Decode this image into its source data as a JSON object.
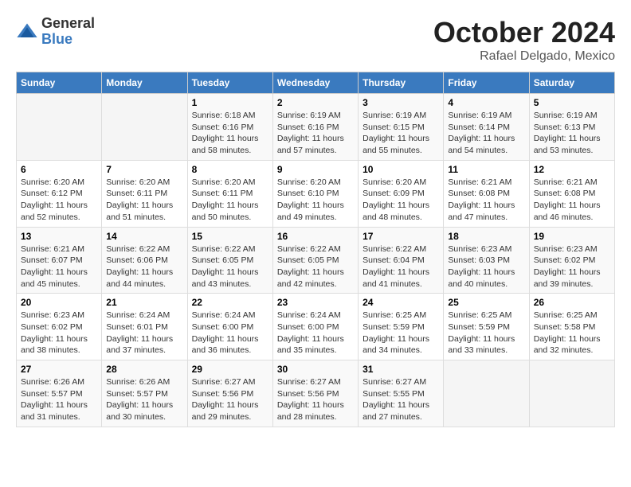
{
  "logo": {
    "general": "General",
    "blue": "Blue"
  },
  "header": {
    "month": "October 2024",
    "location": "Rafael Delgado, Mexico"
  },
  "weekdays": [
    "Sunday",
    "Monday",
    "Tuesday",
    "Wednesday",
    "Thursday",
    "Friday",
    "Saturday"
  ],
  "weeks": [
    [
      {
        "day": "",
        "info": ""
      },
      {
        "day": "",
        "info": ""
      },
      {
        "day": "1",
        "info": "Sunrise: 6:18 AM\nSunset: 6:16 PM\nDaylight: 11 hours and 58 minutes."
      },
      {
        "day": "2",
        "info": "Sunrise: 6:19 AM\nSunset: 6:16 PM\nDaylight: 11 hours and 57 minutes."
      },
      {
        "day": "3",
        "info": "Sunrise: 6:19 AM\nSunset: 6:15 PM\nDaylight: 11 hours and 55 minutes."
      },
      {
        "day": "4",
        "info": "Sunrise: 6:19 AM\nSunset: 6:14 PM\nDaylight: 11 hours and 54 minutes."
      },
      {
        "day": "5",
        "info": "Sunrise: 6:19 AM\nSunset: 6:13 PM\nDaylight: 11 hours and 53 minutes."
      }
    ],
    [
      {
        "day": "6",
        "info": "Sunrise: 6:20 AM\nSunset: 6:12 PM\nDaylight: 11 hours and 52 minutes."
      },
      {
        "day": "7",
        "info": "Sunrise: 6:20 AM\nSunset: 6:11 PM\nDaylight: 11 hours and 51 minutes."
      },
      {
        "day": "8",
        "info": "Sunrise: 6:20 AM\nSunset: 6:11 PM\nDaylight: 11 hours and 50 minutes."
      },
      {
        "day": "9",
        "info": "Sunrise: 6:20 AM\nSunset: 6:10 PM\nDaylight: 11 hours and 49 minutes."
      },
      {
        "day": "10",
        "info": "Sunrise: 6:20 AM\nSunset: 6:09 PM\nDaylight: 11 hours and 48 minutes."
      },
      {
        "day": "11",
        "info": "Sunrise: 6:21 AM\nSunset: 6:08 PM\nDaylight: 11 hours and 47 minutes."
      },
      {
        "day": "12",
        "info": "Sunrise: 6:21 AM\nSunset: 6:08 PM\nDaylight: 11 hours and 46 minutes."
      }
    ],
    [
      {
        "day": "13",
        "info": "Sunrise: 6:21 AM\nSunset: 6:07 PM\nDaylight: 11 hours and 45 minutes."
      },
      {
        "day": "14",
        "info": "Sunrise: 6:22 AM\nSunset: 6:06 PM\nDaylight: 11 hours and 44 minutes."
      },
      {
        "day": "15",
        "info": "Sunrise: 6:22 AM\nSunset: 6:05 PM\nDaylight: 11 hours and 43 minutes."
      },
      {
        "day": "16",
        "info": "Sunrise: 6:22 AM\nSunset: 6:05 PM\nDaylight: 11 hours and 42 minutes."
      },
      {
        "day": "17",
        "info": "Sunrise: 6:22 AM\nSunset: 6:04 PM\nDaylight: 11 hours and 41 minutes."
      },
      {
        "day": "18",
        "info": "Sunrise: 6:23 AM\nSunset: 6:03 PM\nDaylight: 11 hours and 40 minutes."
      },
      {
        "day": "19",
        "info": "Sunrise: 6:23 AM\nSunset: 6:02 PM\nDaylight: 11 hours and 39 minutes."
      }
    ],
    [
      {
        "day": "20",
        "info": "Sunrise: 6:23 AM\nSunset: 6:02 PM\nDaylight: 11 hours and 38 minutes."
      },
      {
        "day": "21",
        "info": "Sunrise: 6:24 AM\nSunset: 6:01 PM\nDaylight: 11 hours and 37 minutes."
      },
      {
        "day": "22",
        "info": "Sunrise: 6:24 AM\nSunset: 6:00 PM\nDaylight: 11 hours and 36 minutes."
      },
      {
        "day": "23",
        "info": "Sunrise: 6:24 AM\nSunset: 6:00 PM\nDaylight: 11 hours and 35 minutes."
      },
      {
        "day": "24",
        "info": "Sunrise: 6:25 AM\nSunset: 5:59 PM\nDaylight: 11 hours and 34 minutes."
      },
      {
        "day": "25",
        "info": "Sunrise: 6:25 AM\nSunset: 5:59 PM\nDaylight: 11 hours and 33 minutes."
      },
      {
        "day": "26",
        "info": "Sunrise: 6:25 AM\nSunset: 5:58 PM\nDaylight: 11 hours and 32 minutes."
      }
    ],
    [
      {
        "day": "27",
        "info": "Sunrise: 6:26 AM\nSunset: 5:57 PM\nDaylight: 11 hours and 31 minutes."
      },
      {
        "day": "28",
        "info": "Sunrise: 6:26 AM\nSunset: 5:57 PM\nDaylight: 11 hours and 30 minutes."
      },
      {
        "day": "29",
        "info": "Sunrise: 6:27 AM\nSunset: 5:56 PM\nDaylight: 11 hours and 29 minutes."
      },
      {
        "day": "30",
        "info": "Sunrise: 6:27 AM\nSunset: 5:56 PM\nDaylight: 11 hours and 28 minutes."
      },
      {
        "day": "31",
        "info": "Sunrise: 6:27 AM\nSunset: 5:55 PM\nDaylight: 11 hours and 27 minutes."
      },
      {
        "day": "",
        "info": ""
      },
      {
        "day": "",
        "info": ""
      }
    ]
  ]
}
